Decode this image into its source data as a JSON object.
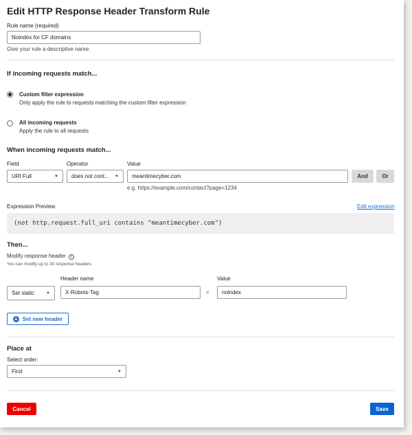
{
  "page_title": "Edit HTTP Response Header Transform Rule",
  "rule_name": {
    "label": "Rule name (required)",
    "value": "Noindex for CF domains",
    "help": "Give your rule a descriptive name."
  },
  "match_section": {
    "heading": "If incoming requests match...",
    "options": [
      {
        "title": "Custom filter expression",
        "desc": "Only apply the rule to requests matching the custom filter expression",
        "selected": true
      },
      {
        "title": "All incoming requests",
        "desc": "Apply the rule to all requests",
        "selected": false
      }
    ]
  },
  "when_section": {
    "heading": "When incoming requests match...",
    "field_label": "Field",
    "operator_label": "Operator",
    "value_label": "Value",
    "field_value": "URI Full",
    "operator_value": "does not cont...",
    "value_value": "meantimecyber.com",
    "value_example": "e.g. https://example.com/contact?page=1234",
    "and_label": "And",
    "or_label": "Or"
  },
  "expression_preview": {
    "label": "Expression Preview",
    "edit_link": "Edit expression",
    "code": "(not http.request.full_uri contains \"meantimecyber.com\")"
  },
  "then_section": {
    "heading": "Then...",
    "modify_label": "Modify response header",
    "modify_help": "You can modify up to 30 response headers",
    "action_value": "Set static",
    "header_name_label": "Header name",
    "header_name_value": "X-Robots-Tag",
    "equals": "=",
    "value_label": "Value",
    "value_value": "noindex",
    "add_button": "Set new header"
  },
  "place_section": {
    "heading": "Place at",
    "order_label": "Select order:",
    "order_value": "First"
  },
  "footer": {
    "cancel": "Cancel",
    "save": "Save"
  },
  "colors": {
    "accent": "#1f6fd1",
    "save": "#0a64d6",
    "cancel": "#ee0000"
  }
}
